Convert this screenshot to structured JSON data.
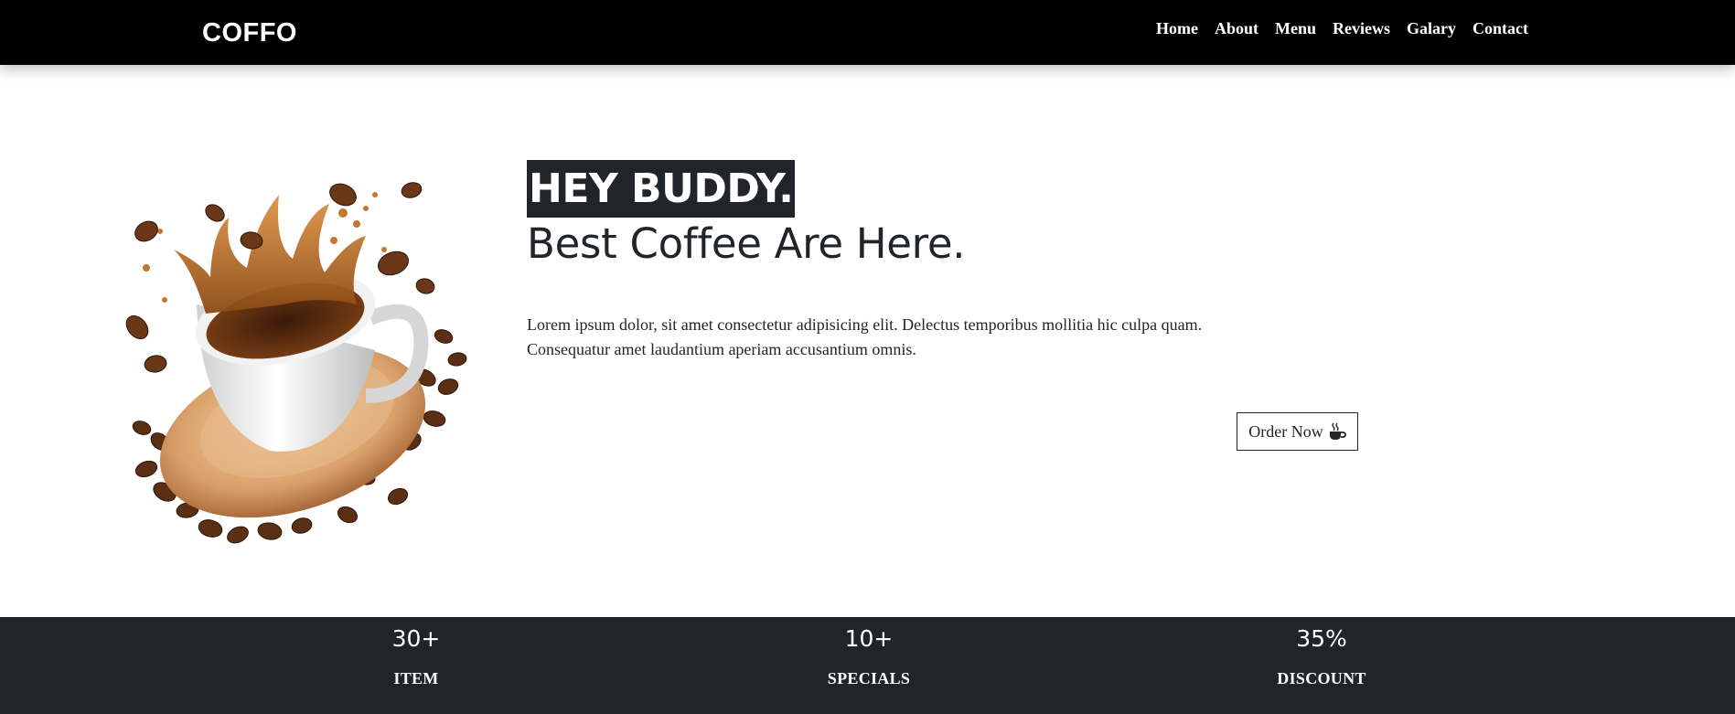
{
  "header": {
    "brand": "COFFO",
    "nav": [
      "Home",
      "About",
      "Menu",
      "Reviews",
      "Galary",
      "Contact"
    ]
  },
  "hero": {
    "highlight": "HEY BUDDY.",
    "headline": "Best Coffee Are Here.",
    "description": "Lorem ipsum dolor, sit amet consectetur adipisicing elit. Delectus temporibus mollitia hic culpa quam. Consequatur amet laudantium aperiam accusantium omnis.",
    "button_label": "Order Now",
    "button_icon": "mug-hot-icon",
    "image_subject": "coffee-cup-splash-image"
  },
  "stats": [
    {
      "value": "30+",
      "label": "ITEM"
    },
    {
      "value": "10+",
      "label": "SPECIALS"
    },
    {
      "value": "35%",
      "label": "DISCOUNT"
    }
  ],
  "colors": {
    "navbar": "#000000",
    "dark": "#212529",
    "text_light": "#ffffff",
    "coffee": "#6b3a1a"
  }
}
